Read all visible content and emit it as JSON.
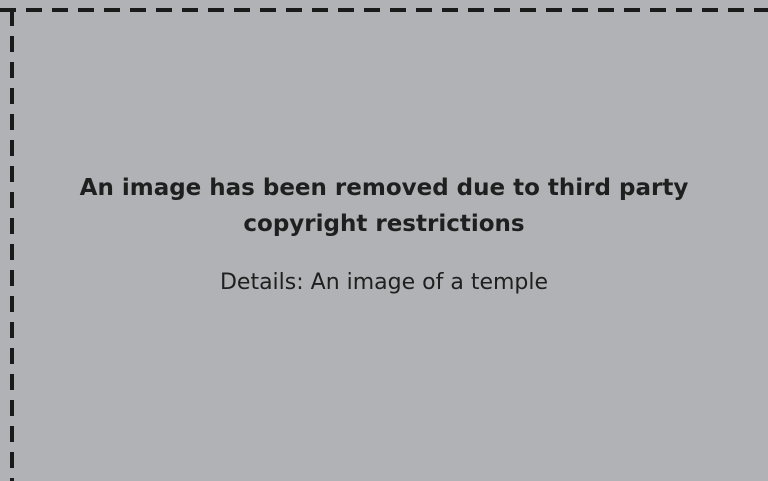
{
  "notice": {
    "title": "An image has been removed due to third party copyright restrictions",
    "details": "Details: An image of a temple"
  },
  "colors": {
    "background": "#b1b2b5",
    "text": "#1f1f1f",
    "border": "#1a1a1a"
  }
}
